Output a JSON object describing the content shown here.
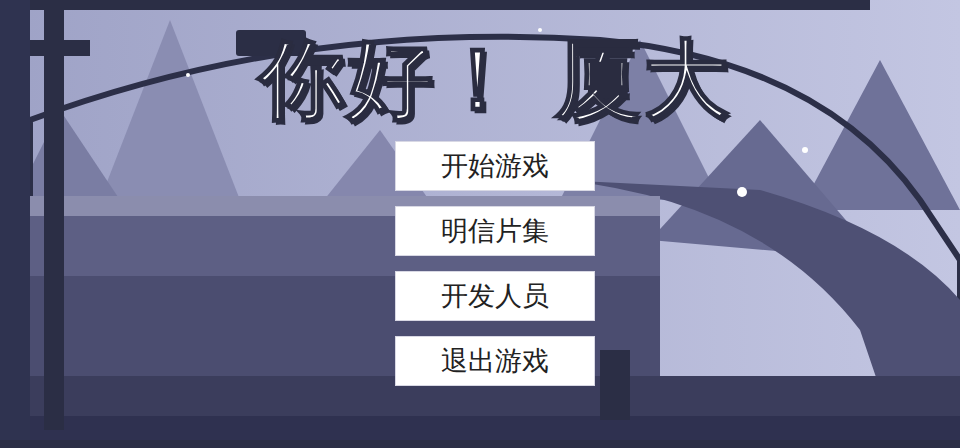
{
  "title": "你好！ 厦大",
  "buttons": [
    "开始游戏",
    "明信片集",
    "开发人员",
    "退出游戏"
  ]
}
